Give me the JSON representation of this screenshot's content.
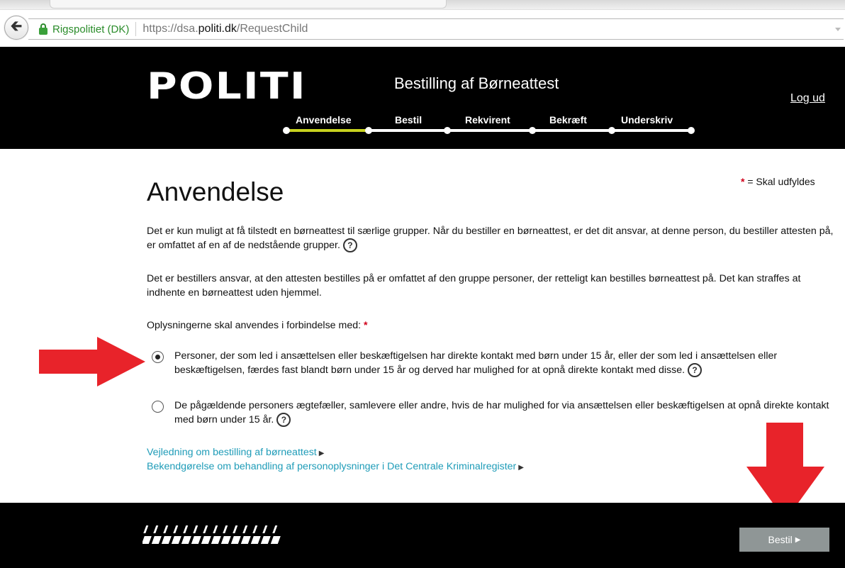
{
  "browser": {
    "site_identity": "Rigspolitiet (DK)",
    "url_prefix": "https://dsa.",
    "url_domain": "politi.dk",
    "url_path": "/RequestChild"
  },
  "header": {
    "logo": "POLITI",
    "title": "Bestilling af Børneattest",
    "logout": "Log ud",
    "steps": [
      "Anvendelse",
      "Bestil",
      "Rekvirent",
      "Bekræft",
      "Underskriv"
    ],
    "active_step": "Anvendelse"
  },
  "main": {
    "required_star": "*",
    "required_legend": "= Skal udfyldes",
    "page_title": "Anvendelse",
    "paragraph1": "Det er kun muligt at få tilstedt en børneattest til særlige grupper. Når du bestiller en børneattest, er det dit ansvar, at denne person, du bestiller attesten på, er omfattet af en af de nedstående grupper.",
    "paragraph2": "Det er bestillers ansvar, at den attesten bestilles på er omfattet af den gruppe personer, der retteligt kan bestilles børneattest på. Det kan straffes at indhente en børneattest uden hjemmel.",
    "question": "Oplysningerne skal anvendes i forbindelse med:",
    "help_symbol": "?",
    "options": [
      {
        "label": "Personer, der som led i ansættelsen eller beskæftigelsen har direkte kontakt med børn under 15 år, eller der som led i ansættelsen eller beskæftigelsen, færdes fast blandt børn under 15 år og derved har mulighed for at opnå direkte kontakt med disse.",
        "selected": true
      },
      {
        "label": "De pågældende personers ægtefæller, samlevere eller andre, hvis de har mulighed for via ansættelsen eller beskæftigelsen at opnå direkte kontakt med børn under 15 år.",
        "selected": false
      }
    ],
    "links": [
      "Vejledning om bestilling af børneattest",
      "Bekendgørelse om behandling af personoplysninger i Det Centrale Kriminalregister"
    ]
  },
  "footer": {
    "submit_label": "Bestil"
  },
  "colors": {
    "header_bg": "#000000",
    "active_step": "#c7d21f",
    "link": "#1f9cb8",
    "required": "#d0021b",
    "annotation_arrow": "#e8232a",
    "submit_bg": "#8f9696"
  }
}
